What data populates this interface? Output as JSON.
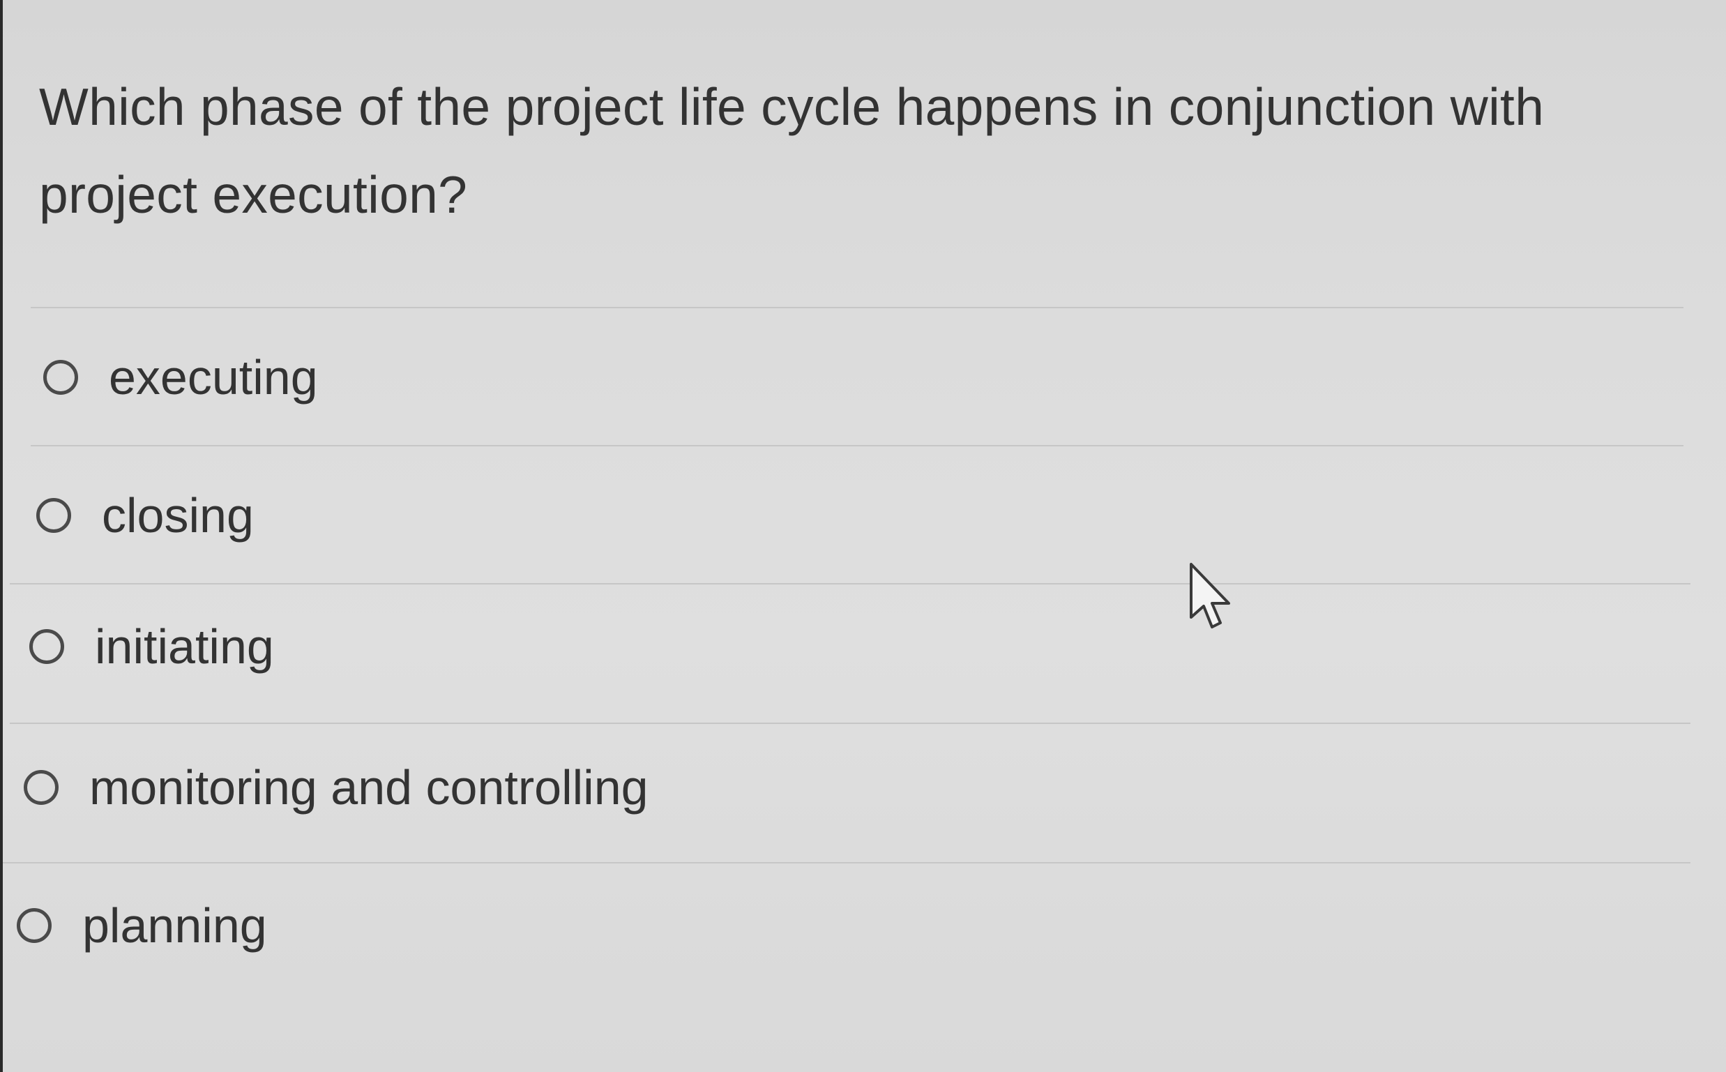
{
  "question": {
    "text": "Which phase of the project life cycle happens in conjunction with project execution?"
  },
  "options": [
    {
      "label": "executing",
      "selected": false
    },
    {
      "label": "closing",
      "selected": false
    },
    {
      "label": "initiating",
      "selected": false
    },
    {
      "label": "monitoring and controlling",
      "selected": false
    },
    {
      "label": "planning",
      "selected": false
    }
  ],
  "icons": {
    "radio": "radio-unchecked-icon",
    "cursor": "mouse-pointer-icon"
  }
}
